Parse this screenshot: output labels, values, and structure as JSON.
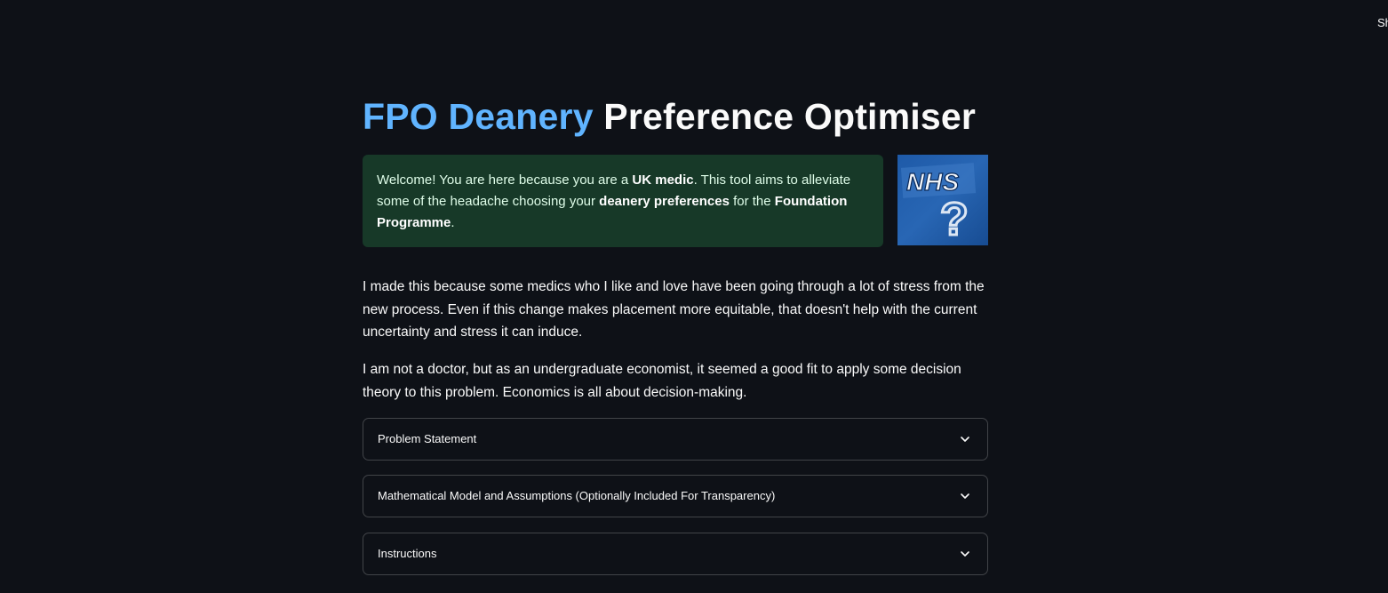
{
  "topbar": {
    "menu_label": "Sh"
  },
  "header": {
    "title_accent": "FPO Deanery",
    "title_rest": "Preference Optimiser"
  },
  "welcome": {
    "t1": "Welcome! You are here because you are a ",
    "b1": "UK medic",
    "t2": ". This tool aims to alleviate some of the headache choosing your ",
    "b2": "deanery preferences",
    "t3": " for the ",
    "b3": "Foundation Programme",
    "t4": "."
  },
  "image": {
    "logo_text": "NHS",
    "glyph": "?"
  },
  "intro": {
    "paragraph1": "I made this because some medics who I like and love have been going through a lot of stress from the new process. Even if this change makes placement more equitable, that doesn't help with the current uncertainty and stress it can induce.",
    "paragraph2": "I am not a doctor, but as an undergraduate economist, it seemed a good fit to apply some decision theory to this problem. Economics is all about decision-making."
  },
  "expanders": [
    {
      "label": "Problem Statement",
      "icon": "chevron-down-icon"
    },
    {
      "label": "Mathematical Model and Assumptions (Optionally Included For Transparency)",
      "icon": "chevron-down-icon"
    },
    {
      "label": "Instructions",
      "icon": "chevron-down-icon"
    }
  ],
  "colors": {
    "background": "#0e1117",
    "accent": "#60b4ff",
    "success_bg": "#173928",
    "success_text": "#dffde9"
  }
}
